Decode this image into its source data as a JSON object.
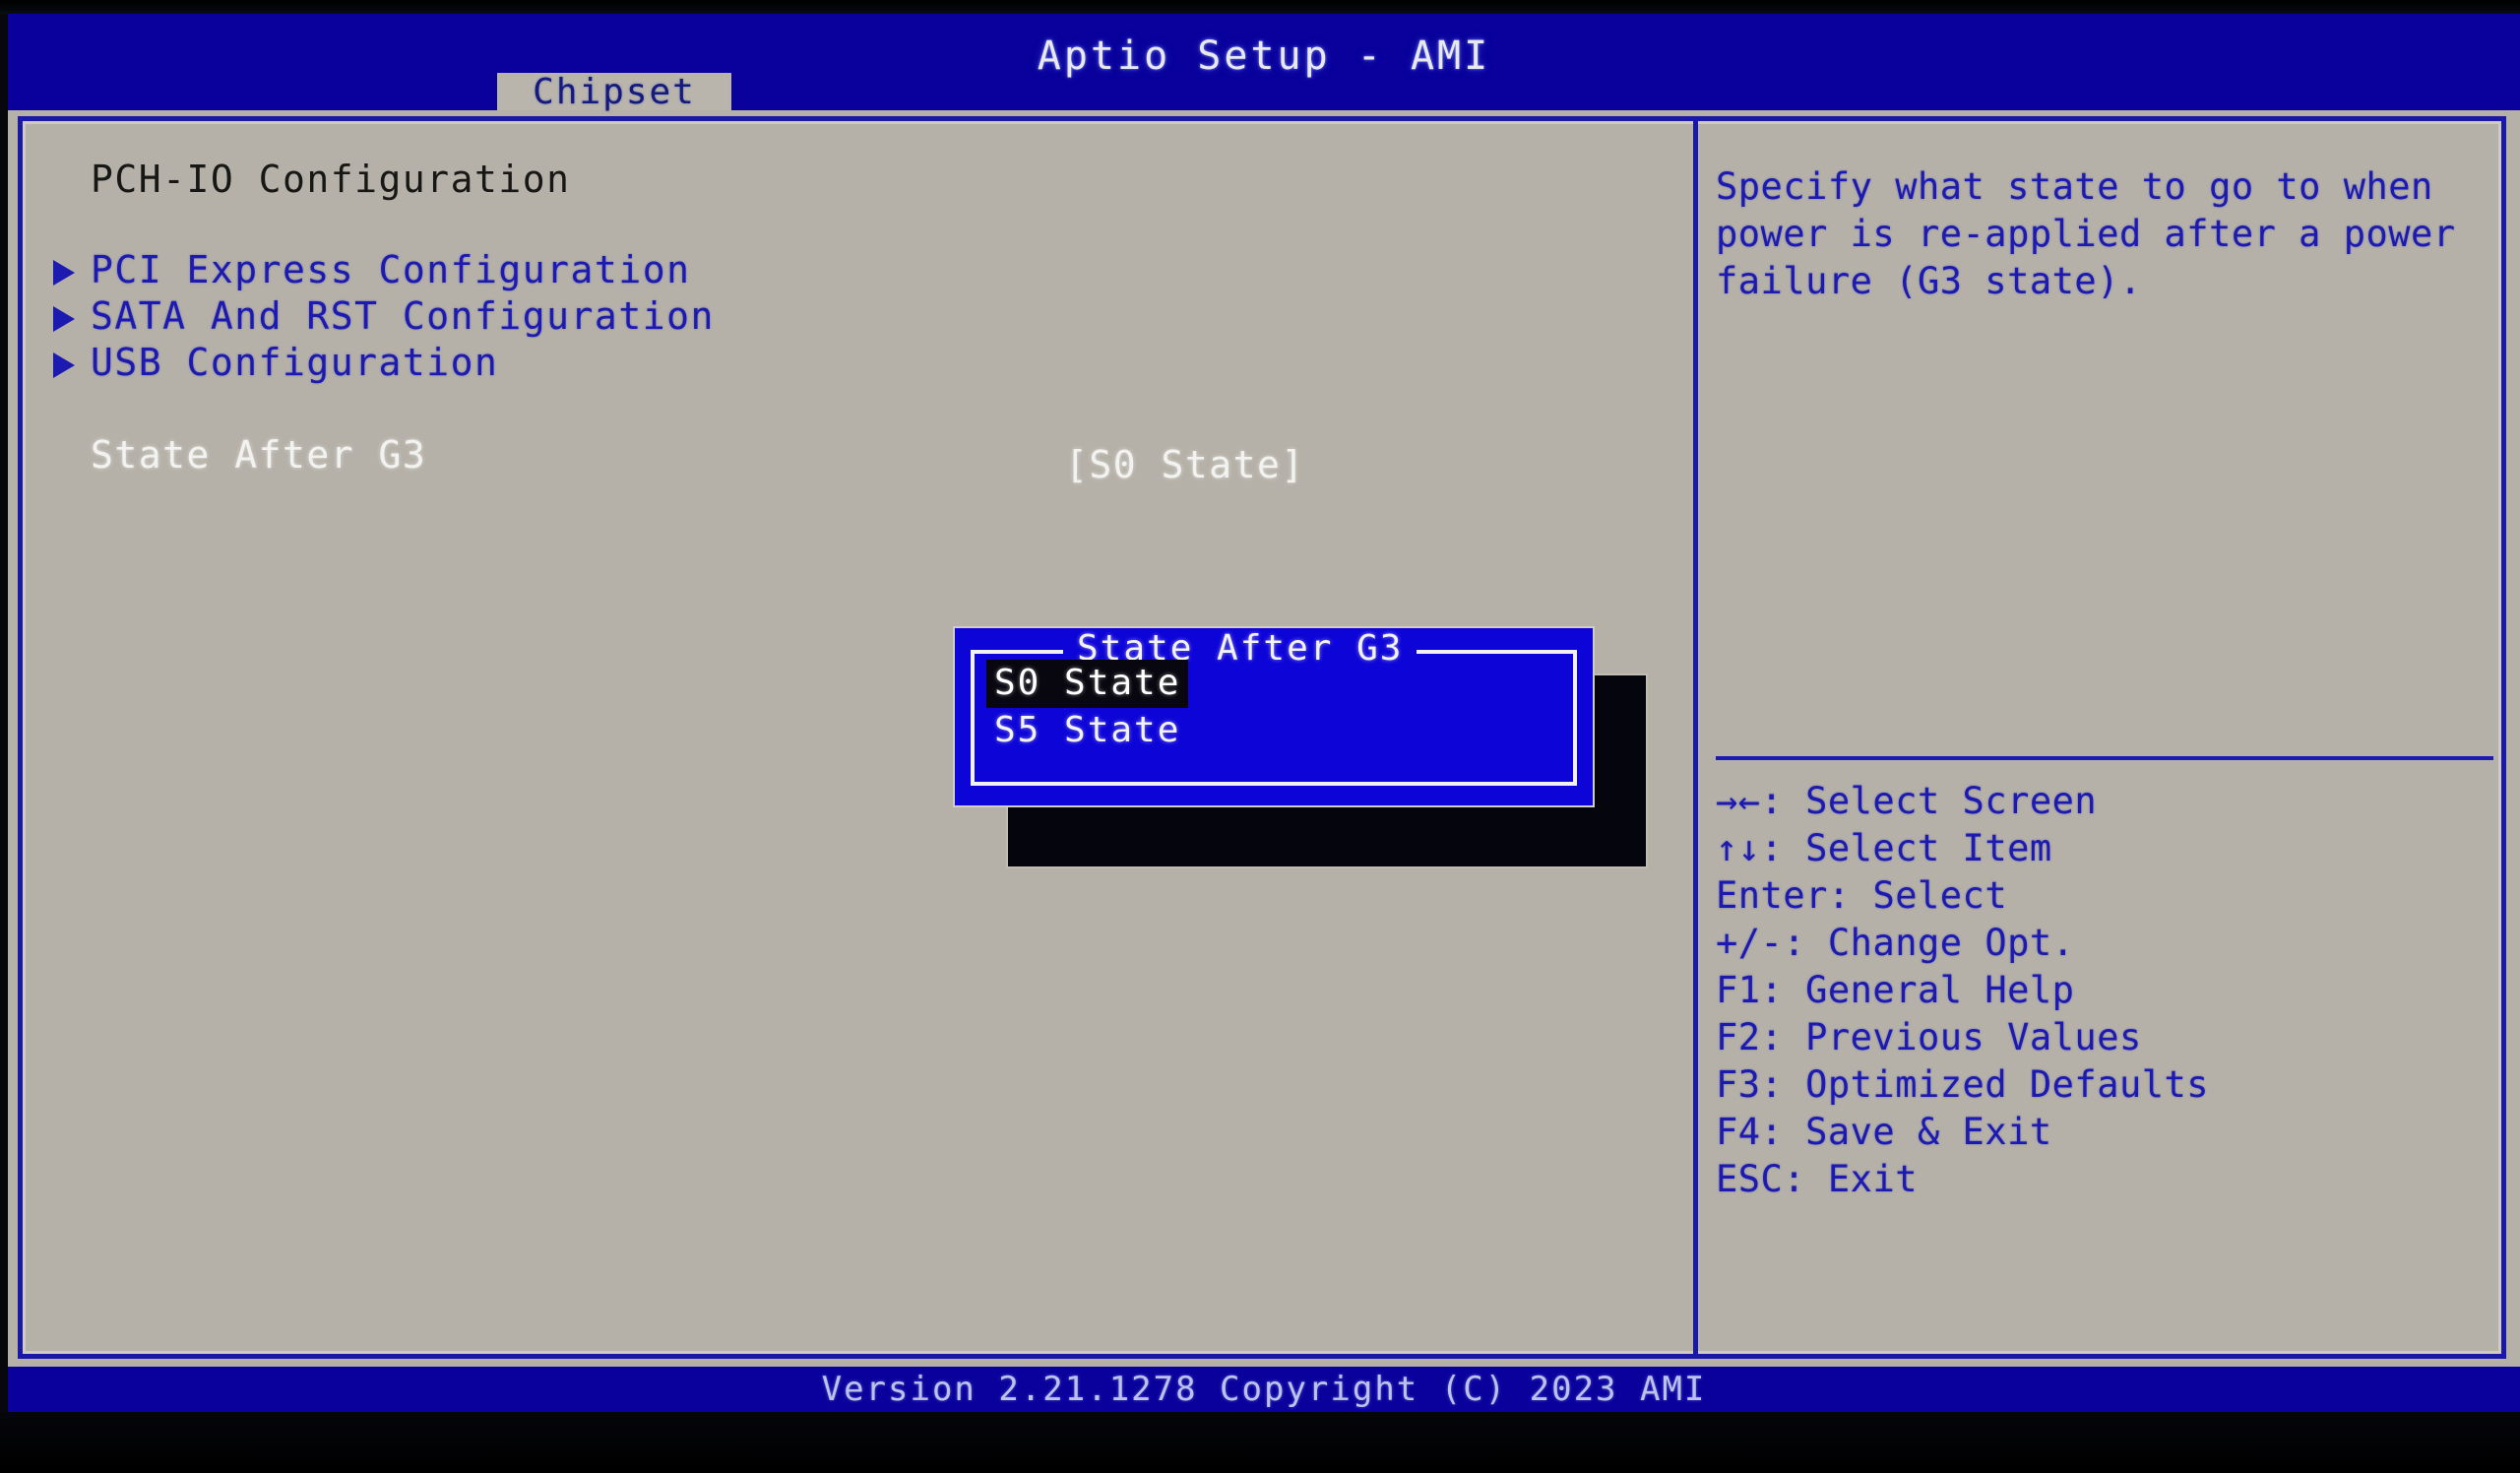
{
  "header": {
    "app_title": "Aptio Setup - AMI",
    "tabs": [
      {
        "label": "Chipset",
        "active": true
      }
    ]
  },
  "main": {
    "page_title": "PCH-IO Configuration",
    "submenus": [
      {
        "label": "PCI Express Configuration",
        "marker": "triangle-right-icon"
      },
      {
        "label": "SATA And RST Configuration",
        "marker": "triangle-right-icon"
      },
      {
        "label": "USB Configuration",
        "marker": "triangle-right-icon"
      }
    ],
    "settings": [
      {
        "label": "State After G3",
        "value": "[S0 State]",
        "selected": true
      }
    ]
  },
  "dialog": {
    "visible": true,
    "title": "State After G3",
    "options": [
      {
        "label": "S0 State",
        "selected": true
      },
      {
        "label": "S5 State",
        "selected": false
      }
    ]
  },
  "help": {
    "text": "Specify what state to go to when power is re-applied after a power failure (G3 state).",
    "shortcuts": [
      {
        "keys": "→←:",
        "action": "Select Screen"
      },
      {
        "keys": "↑↓:",
        "action": "Select Item"
      },
      {
        "keys": "Enter:",
        "action": "Select"
      },
      {
        "keys": "+/-:",
        "action": "Change Opt."
      },
      {
        "keys": "F1:",
        "action": "General Help"
      },
      {
        "keys": "F2:",
        "action": "Previous Values"
      },
      {
        "keys": "F3:",
        "action": "Optimized Defaults"
      },
      {
        "keys": "F4:",
        "action": "Save & Exit"
      },
      {
        "keys": "ESC:",
        "action": "Exit"
      }
    ]
  },
  "footer": {
    "version": "Version 2.21.1278 Copyright (C) 2023 AMI"
  },
  "colors": {
    "header_blue": "#0a009c",
    "panel_gray": "#b5b1a8",
    "accent_blue": "#1d1ab0",
    "dialog_blue": "#0d04d8",
    "highlight_black": "#08060e",
    "text_white": "#f2f2f0"
  }
}
